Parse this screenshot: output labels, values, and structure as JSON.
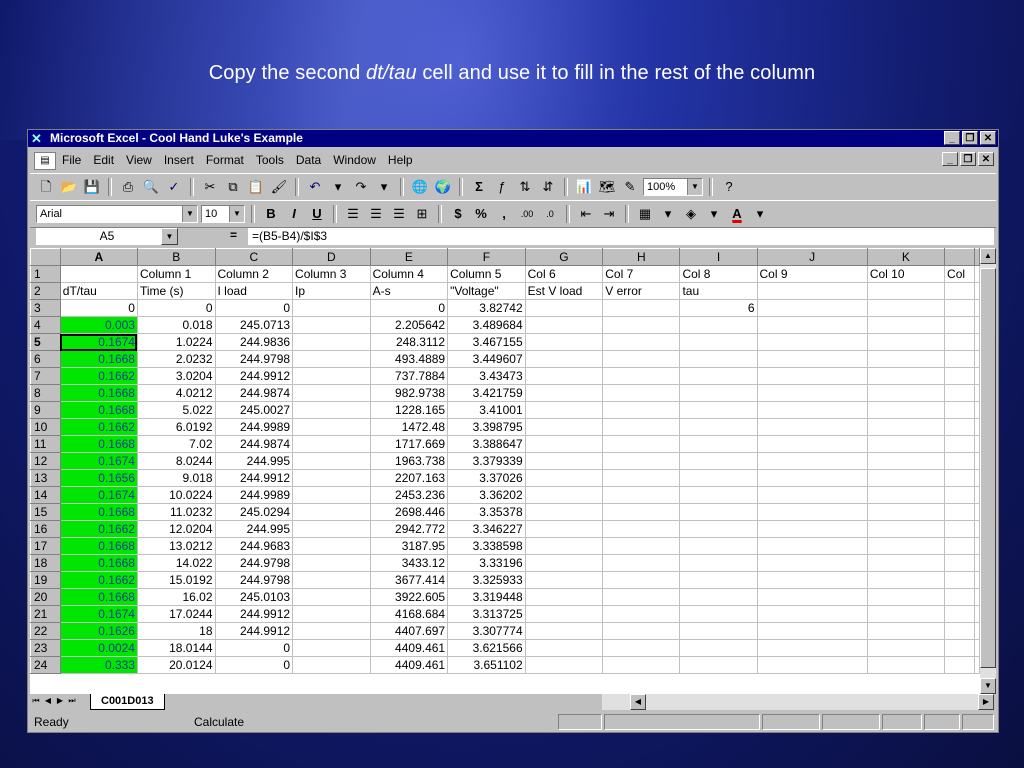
{
  "slide": {
    "title_pre": "Copy the second ",
    "title_italic": "dt/tau",
    "title_post": " cell and use it to fill in the rest of the column"
  },
  "window": {
    "title": "Microsoft Excel - Cool Hand Luke's Example",
    "buttons": [
      "_",
      "❐",
      "✕"
    ]
  },
  "menu": {
    "items": [
      "File",
      "Edit",
      "View",
      "Insert",
      "Format",
      "Tools",
      "Data",
      "Window",
      "Help"
    ]
  },
  "toolbar": {
    "zoom": "100%"
  },
  "format_toolbar": {
    "font": "Arial",
    "size": "10"
  },
  "formula_bar": {
    "name_box": "A5",
    "equals": "=",
    "formula": "=(B5-B4)/$I$3"
  },
  "grid": {
    "col_headers": [
      "A",
      "B",
      "C",
      "D",
      "E",
      "F",
      "G",
      "H",
      "I",
      "J",
      "K",
      ""
    ],
    "rows": [
      {
        "n": "1",
        "cells": [
          "",
          "Column 1",
          "Column 2",
          "Column 3",
          "Column 4",
          "Column 5",
          "Col 6",
          "Col 7",
          "Col 8",
          "Col 9",
          "Col 10",
          "Col"
        ]
      },
      {
        "n": "2",
        "cells": [
          "dT/tau",
          "Time (s)",
          "I load",
          "Ip",
          "A-s",
          "\"Voltage\"",
          "Est V load",
          "V error",
          "tau",
          "",
          "",
          ""
        ]
      },
      {
        "n": "3",
        "cells": [
          "0",
          "0",
          "0",
          "",
          "0",
          "3.82742",
          "",
          "",
          "6",
          "",
          "",
          ""
        ]
      },
      {
        "n": "4",
        "cells": [
          "0.003",
          "0.018",
          "245.0713",
          "",
          "2.205642",
          "3.489684",
          "",
          "",
          "",
          "",
          "",
          ""
        ]
      },
      {
        "n": "5",
        "cells": [
          "0.1674",
          "1.0224",
          "244.9836",
          "",
          "248.3112",
          "3.467155",
          "",
          "",
          "",
          "",
          "",
          ""
        ]
      },
      {
        "n": "6",
        "cells": [
          "0.1668",
          "2.0232",
          "244.9798",
          "",
          "493.4889",
          "3.449607",
          "",
          "",
          "",
          "",
          "",
          ""
        ]
      },
      {
        "n": "7",
        "cells": [
          "0.1662",
          "3.0204",
          "244.9912",
          "",
          "737.7884",
          "3.43473",
          "",
          "",
          "",
          "",
          "",
          ""
        ]
      },
      {
        "n": "8",
        "cells": [
          "0.1668",
          "4.0212",
          "244.9874",
          "",
          "982.9738",
          "3.421759",
          "",
          "",
          "",
          "",
          "",
          ""
        ]
      },
      {
        "n": "9",
        "cells": [
          "0.1668",
          "5.022",
          "245.0027",
          "",
          "1228.165",
          "3.41001",
          "",
          "",
          "",
          "",
          "",
          ""
        ]
      },
      {
        "n": "10",
        "cells": [
          "0.1662",
          "6.0192",
          "244.9989",
          "",
          "1472.48",
          "3.398795",
          "",
          "",
          "",
          "",
          "",
          ""
        ]
      },
      {
        "n": "11",
        "cells": [
          "0.1668",
          "7.02",
          "244.9874",
          "",
          "1717.669",
          "3.388647",
          "",
          "",
          "",
          "",
          "",
          ""
        ]
      },
      {
        "n": "12",
        "cells": [
          "0.1674",
          "8.0244",
          "244.995",
          "",
          "1963.738",
          "3.379339",
          "",
          "",
          "",
          "",
          "",
          ""
        ]
      },
      {
        "n": "13",
        "cells": [
          "0.1656",
          "9.018",
          "244.9912",
          "",
          "2207.163",
          "3.37026",
          "",
          "",
          "",
          "",
          "",
          ""
        ]
      },
      {
        "n": "14",
        "cells": [
          "0.1674",
          "10.0224",
          "244.9989",
          "",
          "2453.236",
          "3.36202",
          "",
          "",
          "",
          "",
          "",
          ""
        ]
      },
      {
        "n": "15",
        "cells": [
          "0.1668",
          "11.0232",
          "245.0294",
          "",
          "2698.446",
          "3.35378",
          "",
          "",
          "",
          "",
          "",
          ""
        ]
      },
      {
        "n": "16",
        "cells": [
          "0.1662",
          "12.0204",
          "244.995",
          "",
          "2942.772",
          "3.346227",
          "",
          "",
          "",
          "",
          "",
          ""
        ]
      },
      {
        "n": "17",
        "cells": [
          "0.1668",
          "13.0212",
          "244.9683",
          "",
          "3187.95",
          "3.338598",
          "",
          "",
          "",
          "",
          "",
          ""
        ]
      },
      {
        "n": "18",
        "cells": [
          "0.1668",
          "14.022",
          "244.9798",
          "",
          "3433.12",
          "3.33196",
          "",
          "",
          "",
          "",
          "",
          ""
        ]
      },
      {
        "n": "19",
        "cells": [
          "0.1662",
          "15.0192",
          "244.9798",
          "",
          "3677.414",
          "3.325933",
          "",
          "",
          "",
          "",
          "",
          ""
        ]
      },
      {
        "n": "20",
        "cells": [
          "0.1668",
          "16.02",
          "245.0103",
          "",
          "3922.605",
          "3.319448",
          "",
          "",
          "",
          "",
          "",
          ""
        ]
      },
      {
        "n": "21",
        "cells": [
          "0.1674",
          "17.0244",
          "244.9912",
          "",
          "4168.684",
          "3.313725",
          "",
          "",
          "",
          "",
          "",
          ""
        ]
      },
      {
        "n": "22",
        "cells": [
          "0.1626",
          "18",
          "244.9912",
          "",
          "4407.697",
          "3.307774",
          "",
          "",
          "",
          "",
          "",
          ""
        ]
      },
      {
        "n": "23",
        "cells": [
          "0.0024",
          "18.0144",
          "0",
          "",
          "4409.461",
          "3.621566",
          "",
          "",
          "",
          "",
          "",
          ""
        ]
      },
      {
        "n": "24",
        "cells": [
          "0.333",
          "20.0124",
          "0",
          "",
          "4409.461",
          "3.651102",
          "",
          "",
          "",
          "",
          "",
          ""
        ]
      }
    ]
  },
  "sheet_tab": "C001D013",
  "status": {
    "ready": "Ready",
    "calc": "Calculate"
  },
  "colors": {
    "title_bar": "#000080",
    "fill_green": "#00e600",
    "chrome": "#c0c0c0"
  }
}
